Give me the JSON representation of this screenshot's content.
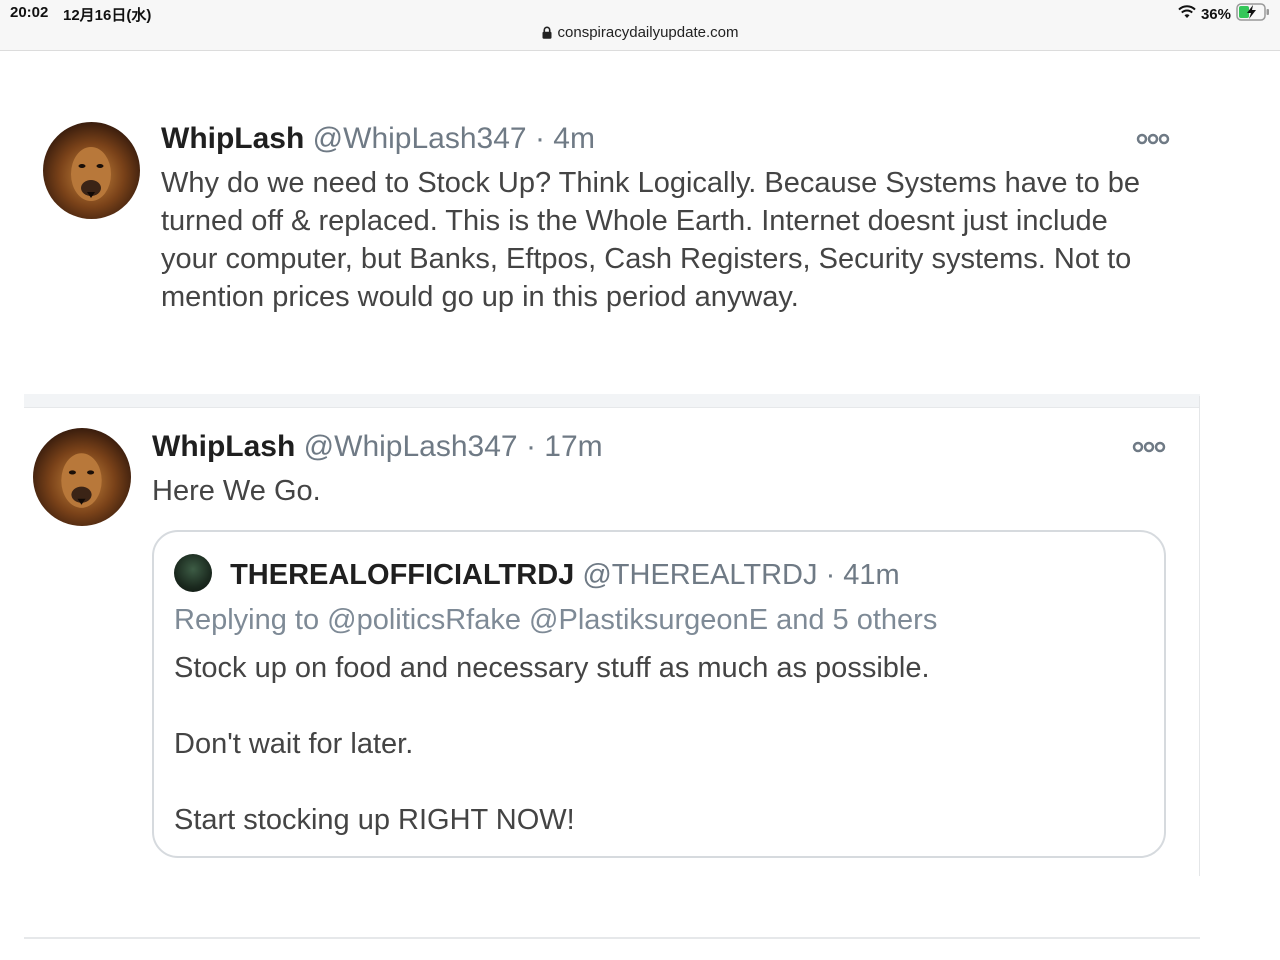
{
  "status_bar": {
    "time": "20:02",
    "date": "12月16日(水)",
    "battery": "36%",
    "url": "conspiracydailyupdate.com"
  },
  "tweets": [
    {
      "name": "WhipLash",
      "handle": "@WhipLash347",
      "time": "· 4m",
      "lines": [
        "Why do we need to Stock Up? Think Logically. Because Systems have to be",
        "turned off & replaced. This is the Whole Earth.  Internet doesnt just include",
        "your computer, but Banks, Eftpos, Cash Registers, Security systems. Not to",
        "mention prices would go up in this period anyway."
      ]
    },
    {
      "name": "WhipLash",
      "handle": "@WhipLash347",
      "time": "· 17m",
      "lines": [
        "Here We Go."
      ],
      "quote": {
        "name": "THEREALOFFICIALTRDJ",
        "handle": "@THEREALTRDJ",
        "time": "· 41m",
        "replying": "Replying to @politicsRfake @PlastiksurgeonE and 5 others",
        "lines": [
          "Stock up on food and necessary stuff as much as possible.",
          "Don't wait for later.",
          "Start stocking up RIGHT NOW!"
        ]
      }
    }
  ],
  "colors": {
    "handle": "#6f7a85",
    "text": "#444444",
    "border": "#d6dade"
  }
}
